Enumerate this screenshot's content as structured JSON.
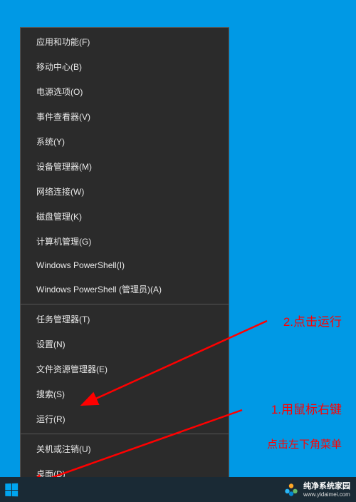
{
  "menu": {
    "items": [
      {
        "label": "应用和功能(F)"
      },
      {
        "label": "移动中心(B)"
      },
      {
        "label": "电源选项(O)"
      },
      {
        "label": "事件查看器(V)"
      },
      {
        "label": "系统(Y)"
      },
      {
        "label": "设备管理器(M)"
      },
      {
        "label": "网络连接(W)"
      },
      {
        "label": "磁盘管理(K)"
      },
      {
        "label": "计算机管理(G)"
      },
      {
        "label": "Windows PowerShell(I)"
      },
      {
        "label": "Windows PowerShell (管理员)(A)"
      }
    ],
    "items2": [
      {
        "label": "任务管理器(T)"
      },
      {
        "label": "设置(N)"
      },
      {
        "label": "文件资源管理器(E)"
      },
      {
        "label": "搜索(S)"
      },
      {
        "label": "运行(R)"
      }
    ],
    "items3": [
      {
        "label": "关机或注销(U)"
      },
      {
        "label": "桌面(D)"
      }
    ]
  },
  "annotations": {
    "step1": "1.用鼠标右键",
    "step1_sub": "点击左下角菜单",
    "step2": "2.点击运行"
  },
  "watermark": {
    "title": "纯净系统家园",
    "url": "www.yidaimei.com"
  }
}
